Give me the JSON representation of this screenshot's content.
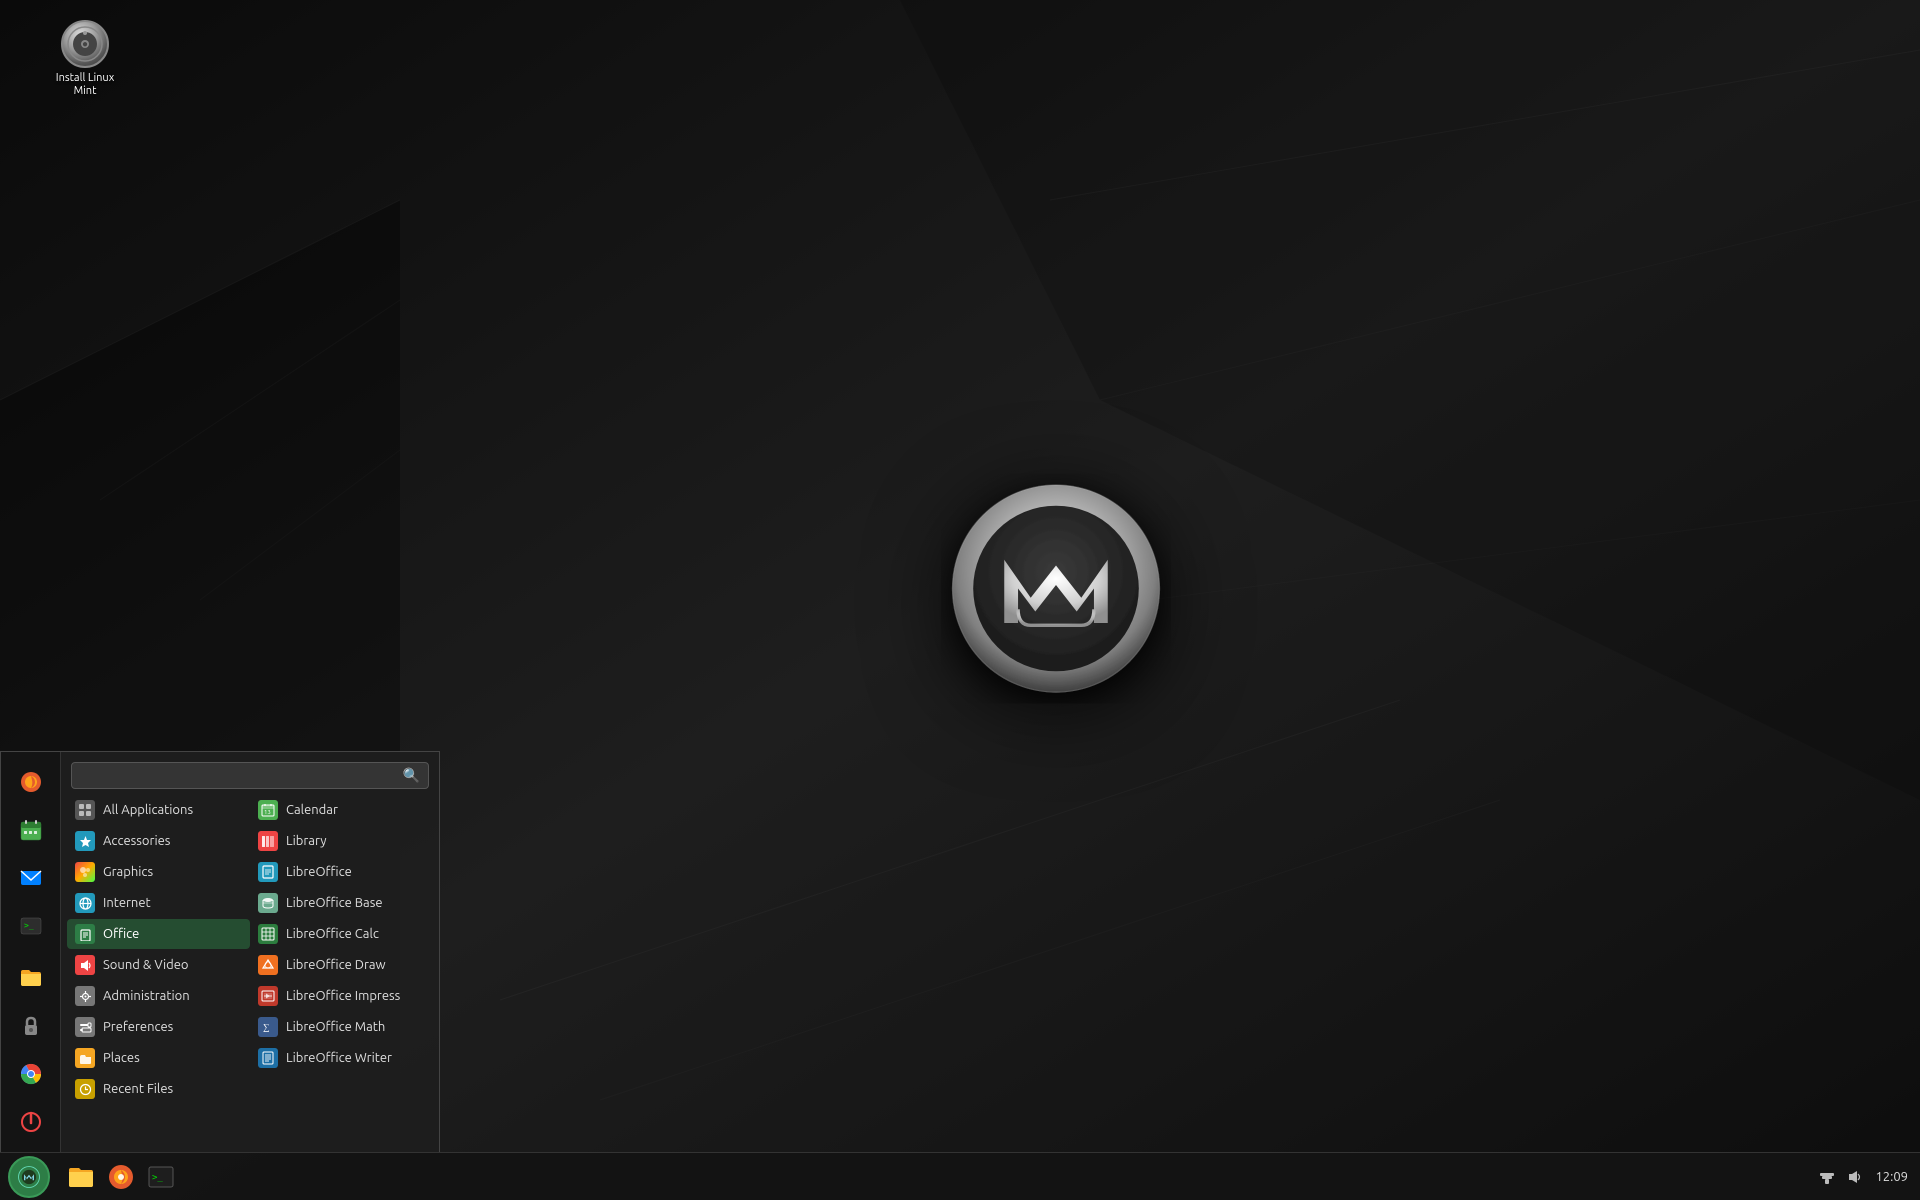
{
  "desktop": {
    "icon": {
      "label": "Install Linux Mint"
    }
  },
  "taskbar": {
    "menu_button_label": "Menu",
    "time": "12:09",
    "apps": [
      {
        "name": "files",
        "label": "Files"
      },
      {
        "name": "firefox",
        "label": "Firefox"
      },
      {
        "name": "terminal",
        "label": "Terminal"
      }
    ]
  },
  "start_menu": {
    "search": {
      "placeholder": ""
    },
    "sidebar_icons": [
      {
        "name": "firefox",
        "label": "Firefox",
        "emoji": "🦊"
      },
      {
        "name": "calendar",
        "label": "Calendar",
        "emoji": "🗓"
      },
      {
        "name": "mail",
        "label": "Mail",
        "emoji": "✉"
      },
      {
        "name": "terminal",
        "label": "Terminal",
        "emoji": ">_"
      },
      {
        "name": "files",
        "label": "Files",
        "emoji": "📁"
      },
      {
        "name": "lock",
        "label": "Lock Screen",
        "emoji": "🔒"
      },
      {
        "name": "google",
        "label": "Google Chrome",
        "emoji": "⊙"
      },
      {
        "name": "power",
        "label": "Power",
        "emoji": "⏻"
      }
    ],
    "left_column": [
      {
        "label": "All Applications",
        "icon": "grid",
        "color": "#aaa",
        "category": "all"
      },
      {
        "label": "Accessories",
        "icon": "🔧",
        "color": "#29b"
      },
      {
        "label": "Graphics",
        "icon": "🎨",
        "color": "#f73",
        "active": false
      },
      {
        "label": "Internet",
        "icon": "🌐",
        "color": "#29b"
      },
      {
        "label": "Office",
        "icon": "📄",
        "color": "#2d7",
        "active": true
      },
      {
        "label": "Sound & Video",
        "icon": "🎬",
        "color": "#e44"
      },
      {
        "label": "Administration",
        "icon": "⚙",
        "color": "#777"
      },
      {
        "label": "Preferences",
        "icon": "🔧",
        "color": "#777"
      },
      {
        "label": "Places",
        "icon": "📁",
        "color": "#f5a623"
      },
      {
        "label": "Recent Files",
        "icon": "🕐",
        "color": "#da4"
      }
    ],
    "right_column": [
      {
        "label": "Calendar",
        "app": "calendar"
      },
      {
        "label": "Library",
        "app": "library"
      },
      {
        "label": "LibreOffice",
        "app": "libreoffice"
      },
      {
        "label": "LibreOffice Base",
        "app": "lo-base"
      },
      {
        "label": "LibreOffice Calc",
        "app": "lo-calc"
      },
      {
        "label": "LibreOffice Draw",
        "app": "lo-draw"
      },
      {
        "label": "LibreOffice Impress",
        "app": "lo-impress"
      },
      {
        "label": "LibreOffice Math",
        "app": "lo-math"
      },
      {
        "label": "LibreOffice Writer",
        "app": "lo-writer"
      }
    ]
  }
}
